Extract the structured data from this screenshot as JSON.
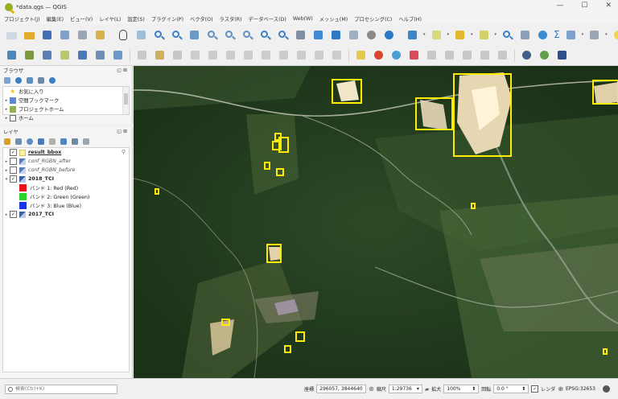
{
  "window": {
    "title": "*data.qgs — QGIS",
    "minimize": "—",
    "maximize": "☐",
    "close": "✕"
  },
  "menu": [
    "プロジェクト(J)",
    "編集(E)",
    "ビュー(V)",
    "レイヤ(L)",
    "設定(S)",
    "プラグイン(P)",
    "ベクタ(O)",
    "ラスタ(R)",
    "データベース(D)",
    "Web(W)",
    "メッシュ(M)",
    "プロセシング(C)",
    "ヘルプ(H)"
  ],
  "browser": {
    "title": "ブラウザ",
    "items": [
      {
        "label": "お気に入り",
        "icon": "star-icon"
      },
      {
        "label": "空間ブックマーク",
        "icon": "bookmark-icon"
      },
      {
        "label": "プロジェクトホーム",
        "icon": "project-home-icon"
      },
      {
        "label": "ホーム",
        "icon": "home-folder-icon"
      }
    ]
  },
  "layers": {
    "title": "レイヤ",
    "items": [
      {
        "label": "result_bbox",
        "checked": true,
        "style": "u"
      },
      {
        "label": "conf_RGBN_after",
        "checked": false,
        "style": "i"
      },
      {
        "label": "conf_RGBN_before",
        "checked": false,
        "style": "i"
      },
      {
        "label": "2018_TCI",
        "checked": true,
        "style": "b"
      }
    ],
    "bands": [
      {
        "label": "バンド 1: Red (Red)",
        "color": "#e8141c"
      },
      {
        "label": "バンド 2: Green (Green)",
        "color": "#2bd12b"
      },
      {
        "label": "バンド 3: Blue (Blue)",
        "color": "#1834e6"
      }
    ],
    "last": {
      "label": "2017_TCI",
      "checked": true
    }
  },
  "status": {
    "search_placeholder": "検索(Ctrl+K)",
    "coord_label": "座標",
    "coord_value": "296057, 3844640",
    "scale_label": "縮尺",
    "scale_value": "1:29736",
    "magnifier_label": "拡大",
    "magnifier_value": "100%",
    "rotation_label": "回転",
    "rotation_value": "0.0 °",
    "render_label": "レンダ",
    "crs": "EPSG:32653"
  },
  "colors": {
    "accent": "#93b023",
    "bbox": "#ffec00"
  }
}
